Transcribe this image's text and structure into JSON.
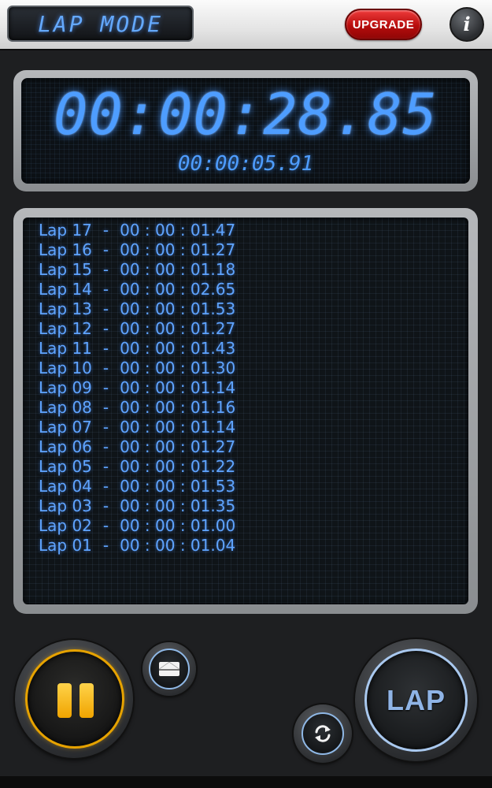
{
  "header": {
    "mode_title": "LAP MODE",
    "upgrade_label": "UPGRADE",
    "info_label": "i"
  },
  "timer": {
    "main_time": "00:00:28.85",
    "current_lap_time": "00:00:05.91"
  },
  "laps": [
    {
      "label": "Lap 17",
      "time": "00 : 00 : 01.47"
    },
    {
      "label": "Lap 16",
      "time": "00 : 00 : 01.27"
    },
    {
      "label": "Lap 15",
      "time": "00 : 00 : 01.18"
    },
    {
      "label": "Lap 14",
      "time": "00 : 00 : 02.65"
    },
    {
      "label": "Lap 13",
      "time": "00 : 00 : 01.53"
    },
    {
      "label": "Lap 12",
      "time": "00 : 00 : 01.27"
    },
    {
      "label": "Lap 11",
      "time": "00 : 00 : 01.43"
    },
    {
      "label": "Lap 10",
      "time": "00 : 00 : 01.30"
    },
    {
      "label": "Lap 09",
      "time": "00 : 00 : 01.14"
    },
    {
      "label": "Lap 08",
      "time": "00 : 00 : 01.16"
    },
    {
      "label": "Lap 07",
      "time": "00 : 00 : 01.14"
    },
    {
      "label": "Lap 06",
      "time": "00 : 00 : 01.27"
    },
    {
      "label": "Lap 05",
      "time": "00 : 00 : 01.22"
    },
    {
      "label": "Lap 04",
      "time": "00 : 00 : 01.53"
    },
    {
      "label": "Lap 03",
      "time": "00 : 00 : 01.35"
    },
    {
      "label": "Lap 02",
      "time": "00 : 00 : 01.00"
    },
    {
      "label": "Lap 01",
      "time": "00 : 00 : 01.04"
    }
  ],
  "lap_separator": "-",
  "controls": {
    "lap_label": "LAP",
    "pause_icon": "pause-icon",
    "email_icon": "envelope-icon",
    "reset_icon": "reset-icon"
  },
  "colors": {
    "lcd_blue": "#4e9dff",
    "pause_accent": "#f0a400",
    "upgrade_red": "#c41414"
  }
}
